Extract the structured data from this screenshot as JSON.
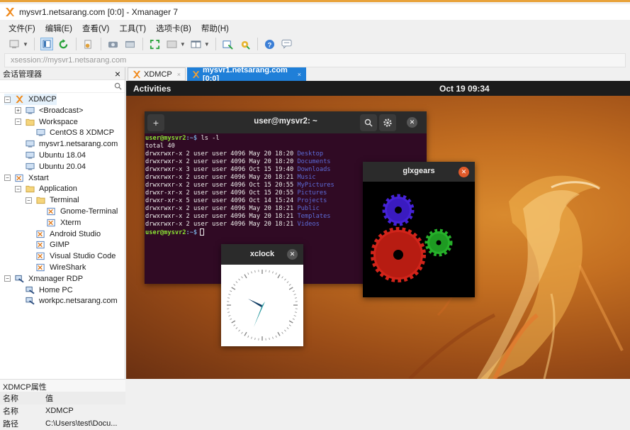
{
  "window": {
    "title": "mysvr1.netsarang.com [0:0] - Xmanager 7"
  },
  "menu": [
    "文件(F)",
    "编辑(E)",
    "查看(V)",
    "工具(T)",
    "选项卡(B)",
    "帮助(H)"
  ],
  "address": "xsession://mysvr1.netsarang.com",
  "sidebar": {
    "title": "会话管理器",
    "close": "×",
    "tree": [
      {
        "label": "XDMCP",
        "level": 0,
        "expander": "−",
        "icon": "xmanager-x-icon"
      },
      {
        "label": "<Broadcast>",
        "level": 1,
        "expander": "+",
        "icon": "monitor-icon"
      },
      {
        "label": "Workspace",
        "level": 1,
        "expander": "−",
        "icon": "folder-icon"
      },
      {
        "label": "CentOS 8 XDMCP",
        "level": 2,
        "expander": "",
        "icon": "monitor-icon"
      },
      {
        "label": "mysvr1.netsarang.com",
        "level": 1,
        "expander": "",
        "icon": "monitor-icon"
      },
      {
        "label": "Ubuntu 18.04",
        "level": 1,
        "expander": "",
        "icon": "monitor-icon"
      },
      {
        "label": "Ubuntu 20.04",
        "level": 1,
        "expander": "",
        "icon": "monitor-icon"
      },
      {
        "label": "Xstart",
        "level": 0,
        "expander": "−",
        "icon": "xstart-icon"
      },
      {
        "label": "Application",
        "level": 1,
        "expander": "−",
        "icon": "folder-icon"
      },
      {
        "label": "Terminal",
        "level": 2,
        "expander": "−",
        "icon": "folder-icon"
      },
      {
        "label": "Gnome-Terminal",
        "level": 3,
        "expander": "",
        "icon": "xstart-icon"
      },
      {
        "label": "Xterm",
        "level": 3,
        "expander": "",
        "icon": "xstart-icon"
      },
      {
        "label": "Android Studio",
        "level": 2,
        "expander": "",
        "icon": "xstart-icon"
      },
      {
        "label": "GIMP",
        "level": 2,
        "expander": "",
        "icon": "xstart-icon"
      },
      {
        "label": "Visual Studio Code",
        "level": 2,
        "expander": "",
        "icon": "xstart-icon"
      },
      {
        "label": "WireShark",
        "level": 2,
        "expander": "",
        "icon": "xstart-icon"
      },
      {
        "label": "Xmanager RDP",
        "level": 0,
        "expander": "−",
        "icon": "rdp-icon"
      },
      {
        "label": "Home PC",
        "level": 1,
        "expander": "",
        "icon": "rdp-icon"
      },
      {
        "label": "workpc.netsarang.com",
        "level": 1,
        "expander": "",
        "icon": "rdp-icon"
      }
    ],
    "props_title": "XDMCP属性",
    "props_header": {
      "k": "名称",
      "v": "值"
    },
    "props": [
      {
        "k": "名称",
        "v": "XDMCP"
      },
      {
        "k": "路径",
        "v": "C:\\Users\\test\\Docu..."
      }
    ]
  },
  "tabs": [
    {
      "label": "XDMCP",
      "close": "×"
    },
    {
      "label": "mysvr1.netsarang.com [0:0]",
      "close": "×"
    }
  ],
  "remote": {
    "activities": "Activities",
    "clock": "Oct 19  09:34",
    "terminal": {
      "title": "user@mysvr2: ~",
      "prompt": "user@mysvr2",
      "prompt_path": ":~$",
      "command": " ls -l",
      "total": "total 40",
      "rows": [
        {
          "meta": "drwxrwxr-x 2 user user 4096 May 20 18:20 ",
          "name": "Desktop"
        },
        {
          "meta": "drwxrwxr-x 2 user user 4096 May 20 18:20 ",
          "name": "Documents"
        },
        {
          "meta": "drwxrwxr-x 3 user user 4096 Oct 15 19:40 ",
          "name": "Downloads"
        },
        {
          "meta": "drwxrwxr-x 2 user user 4096 May 20 18:21 ",
          "name": "Music"
        },
        {
          "meta": "drwxrwxr-x 2 user user 4096 Oct 15 20:55 ",
          "name": "MyPictures"
        },
        {
          "meta": "drwxr-xr-x 2 user user 4096 Oct 15 20:55 ",
          "name": "Pictures"
        },
        {
          "meta": "drwxr-xr-x 5 user user 4096 Oct 14 15:24 ",
          "name": "Projects"
        },
        {
          "meta": "drwxrwxr-x 2 user user 4096 May 20 18:21 ",
          "name": "Public"
        },
        {
          "meta": "drwxrwxr-x 2 user user 4096 May 20 18:21 ",
          "name": "Templates"
        },
        {
          "meta": "drwxrwxr-x 2 user user 4096 May 20 18:21 ",
          "name": "Videos"
        }
      ]
    },
    "glxgears": {
      "title": "glxgears"
    },
    "xclock": {
      "title": "xclock"
    }
  }
}
